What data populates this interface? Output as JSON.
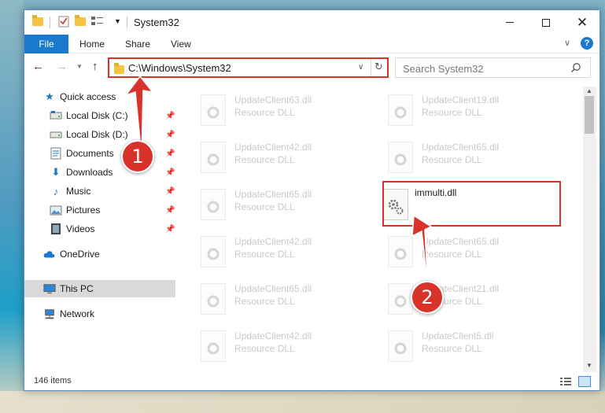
{
  "window": {
    "title": "System32",
    "close_glyph": "✕"
  },
  "ribbon": {
    "tabs": [
      "File",
      "Home",
      "Share",
      "View"
    ]
  },
  "navigation": {
    "address": "C:\\Windows\\System32",
    "search_placeholder": "Search System32"
  },
  "sidebar": {
    "items": [
      {
        "label": "Quick access",
        "icon": "star-icon",
        "pinned": false
      },
      {
        "label": "Local Disk (C:)",
        "icon": "drive-icon",
        "pinned": true
      },
      {
        "label": "Local Disk (D:)",
        "icon": "drive-icon",
        "pinned": true
      },
      {
        "label": "Documents",
        "icon": "documents-icon",
        "pinned": true
      },
      {
        "label": "Downloads",
        "icon": "download-icon",
        "pinned": true
      },
      {
        "label": "Music",
        "icon": "music-icon",
        "pinned": true
      },
      {
        "label": "Pictures",
        "icon": "pictures-icon",
        "pinned": true
      },
      {
        "label": "Videos",
        "icon": "videos-icon",
        "pinned": true
      },
      {
        "label": "OneDrive",
        "icon": "cloud-icon",
        "pinned": false
      },
      {
        "label": "This PC",
        "icon": "computer-icon",
        "pinned": false,
        "selected": true
      },
      {
        "label": "Network",
        "icon": "network-icon",
        "pinned": false
      }
    ]
  },
  "files": [
    {
      "name": "UpdateClient63.dll",
      "type": "Resource DLL",
      "faded": true
    },
    {
      "name": "UpdateClient19.dll",
      "type": "Resource DLL",
      "faded": true
    },
    {
      "name": "UpdateClient42.dll",
      "type": "Resource DLL",
      "faded": true
    },
    {
      "name": "UpdateClient65.dll",
      "type": "Resource DLL",
      "faded": true
    },
    {
      "name": "UpdateClient65.dll",
      "type": "Resource DLL",
      "faded": true
    },
    {
      "name": "immulti.dll",
      "type": "",
      "faded": false,
      "highlighted": true
    },
    {
      "name": "UpdateClient42.dll",
      "type": "Resource DLL",
      "faded": true
    },
    {
      "name": "UpdateClient65.dll",
      "type": "Resource DLL",
      "faded": true
    },
    {
      "name": "UpdateClient65.dll",
      "type": "Resource DLL",
      "faded": true
    },
    {
      "name": "UpdateClient21.dll",
      "type": "Resource DLL",
      "faded": true
    },
    {
      "name": "UpdateClient42.dll",
      "type": "Resource DLL",
      "faded": true
    },
    {
      "name": "UpdateClient5.dll",
      "type": "Resource DLL",
      "faded": true
    }
  ],
  "status": {
    "item_count": "146 items"
  },
  "callouts": {
    "step1": "1",
    "step2": "2",
    "accent_color": "#d9322b"
  }
}
